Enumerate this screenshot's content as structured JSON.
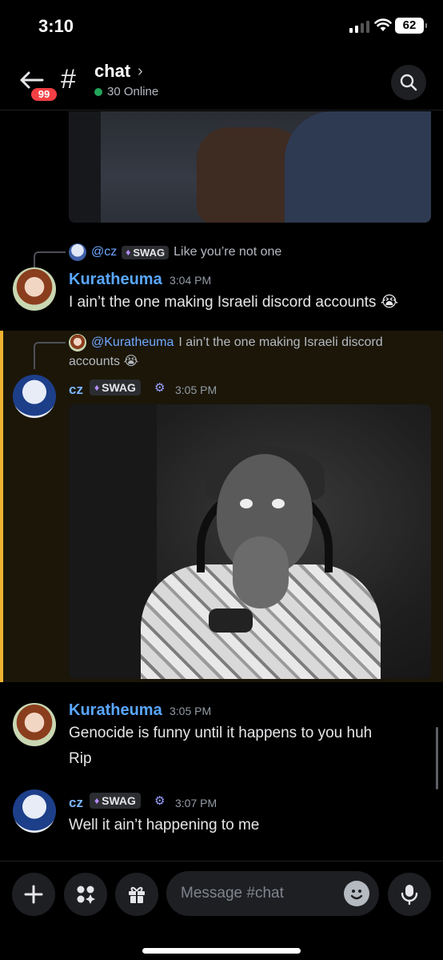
{
  "status_bar": {
    "time": "3:10",
    "battery": "62"
  },
  "header": {
    "unread_badge": "99",
    "channel_hash": "#",
    "channel_name": "chat",
    "online_text": "30 Online"
  },
  "messages": [
    {
      "reply_to": {
        "mention": "@cz",
        "tag": "SWAG",
        "text": "Like you’re not one"
      },
      "author": "Kuratheuma",
      "time": "3:04 PM",
      "text": "I ain’t the one making Israeli discord accounts 😭"
    },
    {
      "reply_to": {
        "mention": "@Kuratheuma",
        "text_line1": "I ain’t the one making Israeli discord",
        "text_line2": "accounts 😭"
      },
      "author": "cz",
      "tag": "SWAG",
      "time": "3:05 PM",
      "attachment": "gif"
    },
    {
      "author": "Kuratheuma",
      "time": "3:05 PM",
      "text": "Genocide is funny until it happens to you huh",
      "text2": "Rip"
    },
    {
      "author": "cz",
      "tag": "SWAG",
      "time": "3:07 PM",
      "text": "Well it ain’t happening to me"
    }
  ],
  "composer": {
    "placeholder": "Message #chat"
  },
  "icons": [
    "back-arrow-icon",
    "search-icon",
    "plus-icon",
    "apps-icon",
    "gift-icon",
    "emoji-icon",
    "microphone-icon"
  ],
  "colors": {
    "accent_name": "#5aa7ff",
    "highlight_bar": "#f0b232",
    "badge": "#f23f43",
    "online": "#23a55a"
  }
}
